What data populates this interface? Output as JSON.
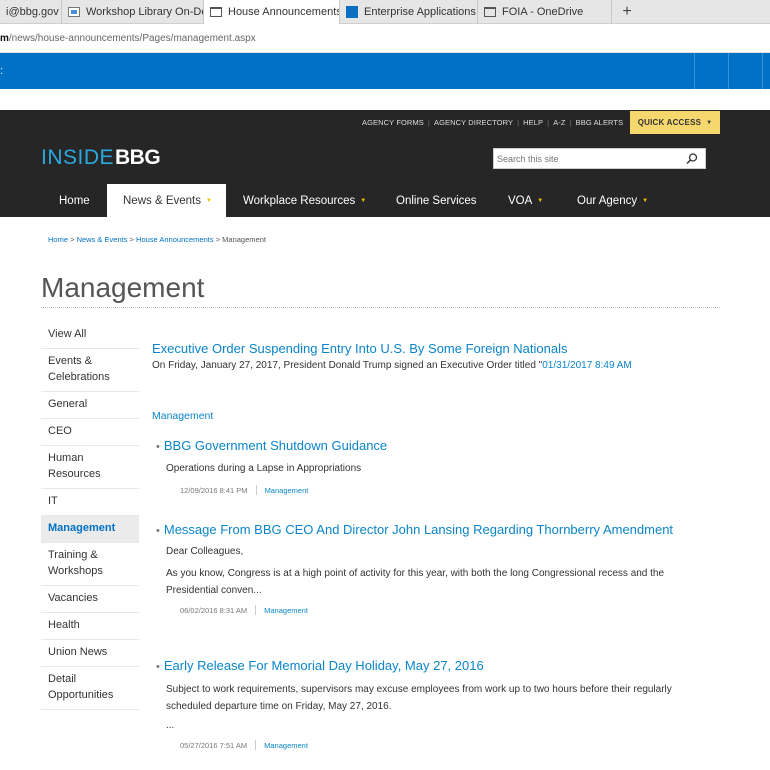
{
  "browser": {
    "tabs": [
      {
        "label": "i@bbg.gov",
        "icon": "mail-icon"
      },
      {
        "label": "Workshop Library On-Dema",
        "icon": "video-icon"
      },
      {
        "label": "House Announcements",
        "icon": "page-icon",
        "close": "×"
      },
      {
        "label": "Enterprise Applications Limi",
        "icon": "sharepoint-icon"
      },
      {
        "label": "FOIA - OneDrive",
        "icon": "page-icon"
      }
    ],
    "newtab": "+",
    "url_host": "m",
    "url_path": "/news/house-announcements/Pages/management.aspx",
    "bluebar_mark": ":"
  },
  "utility": {
    "links": [
      "AGENCY FORMS",
      "AGENCY DIRECTORY",
      "HELP",
      "A-Z",
      "BBG ALERTS"
    ],
    "quick_access": "QUICK ACCESS"
  },
  "header": {
    "logo_inside": "INSIDE",
    "logo_bbg": "BBG",
    "search_placeholder": "Search this site"
  },
  "nav": [
    {
      "label": "Home",
      "caret": ""
    },
    {
      "label": "News & Events",
      "caret": "▼"
    },
    {
      "label": "Workplace Resources",
      "caret": "▼"
    },
    {
      "label": "Online Services",
      "caret": ""
    },
    {
      "label": "VOA",
      "caret": "▼"
    },
    {
      "label": "Our Agency",
      "caret": "▼"
    }
  ],
  "breadcrumb": {
    "home": "Home",
    "news": "News & Events",
    "house": "House Announcements",
    "current": "Management",
    "sep": ">"
  },
  "page": {
    "title": "Management"
  },
  "leftnav": [
    "View All",
    "Events & Celebrations",
    "General",
    "CEO",
    "Human Resources",
    "IT",
    "Management",
    "Training & Workshops",
    "Vacancies",
    "Health",
    "Union News",
    "Detail Opportunities"
  ],
  "featured": {
    "title": "Executive Order Suspending Entry Into U.S. By Some Foreign Nationals",
    "desc": "On Friday, January 27, 2017, President Donald Trump signed an Executive Order titled \"",
    "date": "01/31/2017 8:49 AM"
  },
  "section": "Management",
  "articles": [
    {
      "bullet": "•",
      "title": "BBG Government Shutdown Guidance",
      "body1": "Operations during a Lapse in Appropriations",
      "body2": "",
      "date": "12/09/2016 8:41 PM",
      "category": "Management"
    },
    {
      "bullet": "•",
      "title": "Message From BBG CEO And Director John Lansing Regarding Thornberry Amendment",
      "body1": "Dear Colleagues,",
      "body2": "As you know, Congress is at a high point of activity for this year, with both the long Congressional recess and the Presidential conven...",
      "date": "06/02/2016 8:31 AM",
      "category": "Management"
    },
    {
      "bullet": "•",
      "title": "Early Release For Memorial Day Holiday, May 27, 2016",
      "body1": "Subject to work requirements, supervisors may excuse employees from work up to two hours before their regularly scheduled departure time on Friday, May 27, 2016.",
      "body2": "...",
      "date": "05/27/2016 7:51 AM",
      "category": "Management"
    }
  ]
}
